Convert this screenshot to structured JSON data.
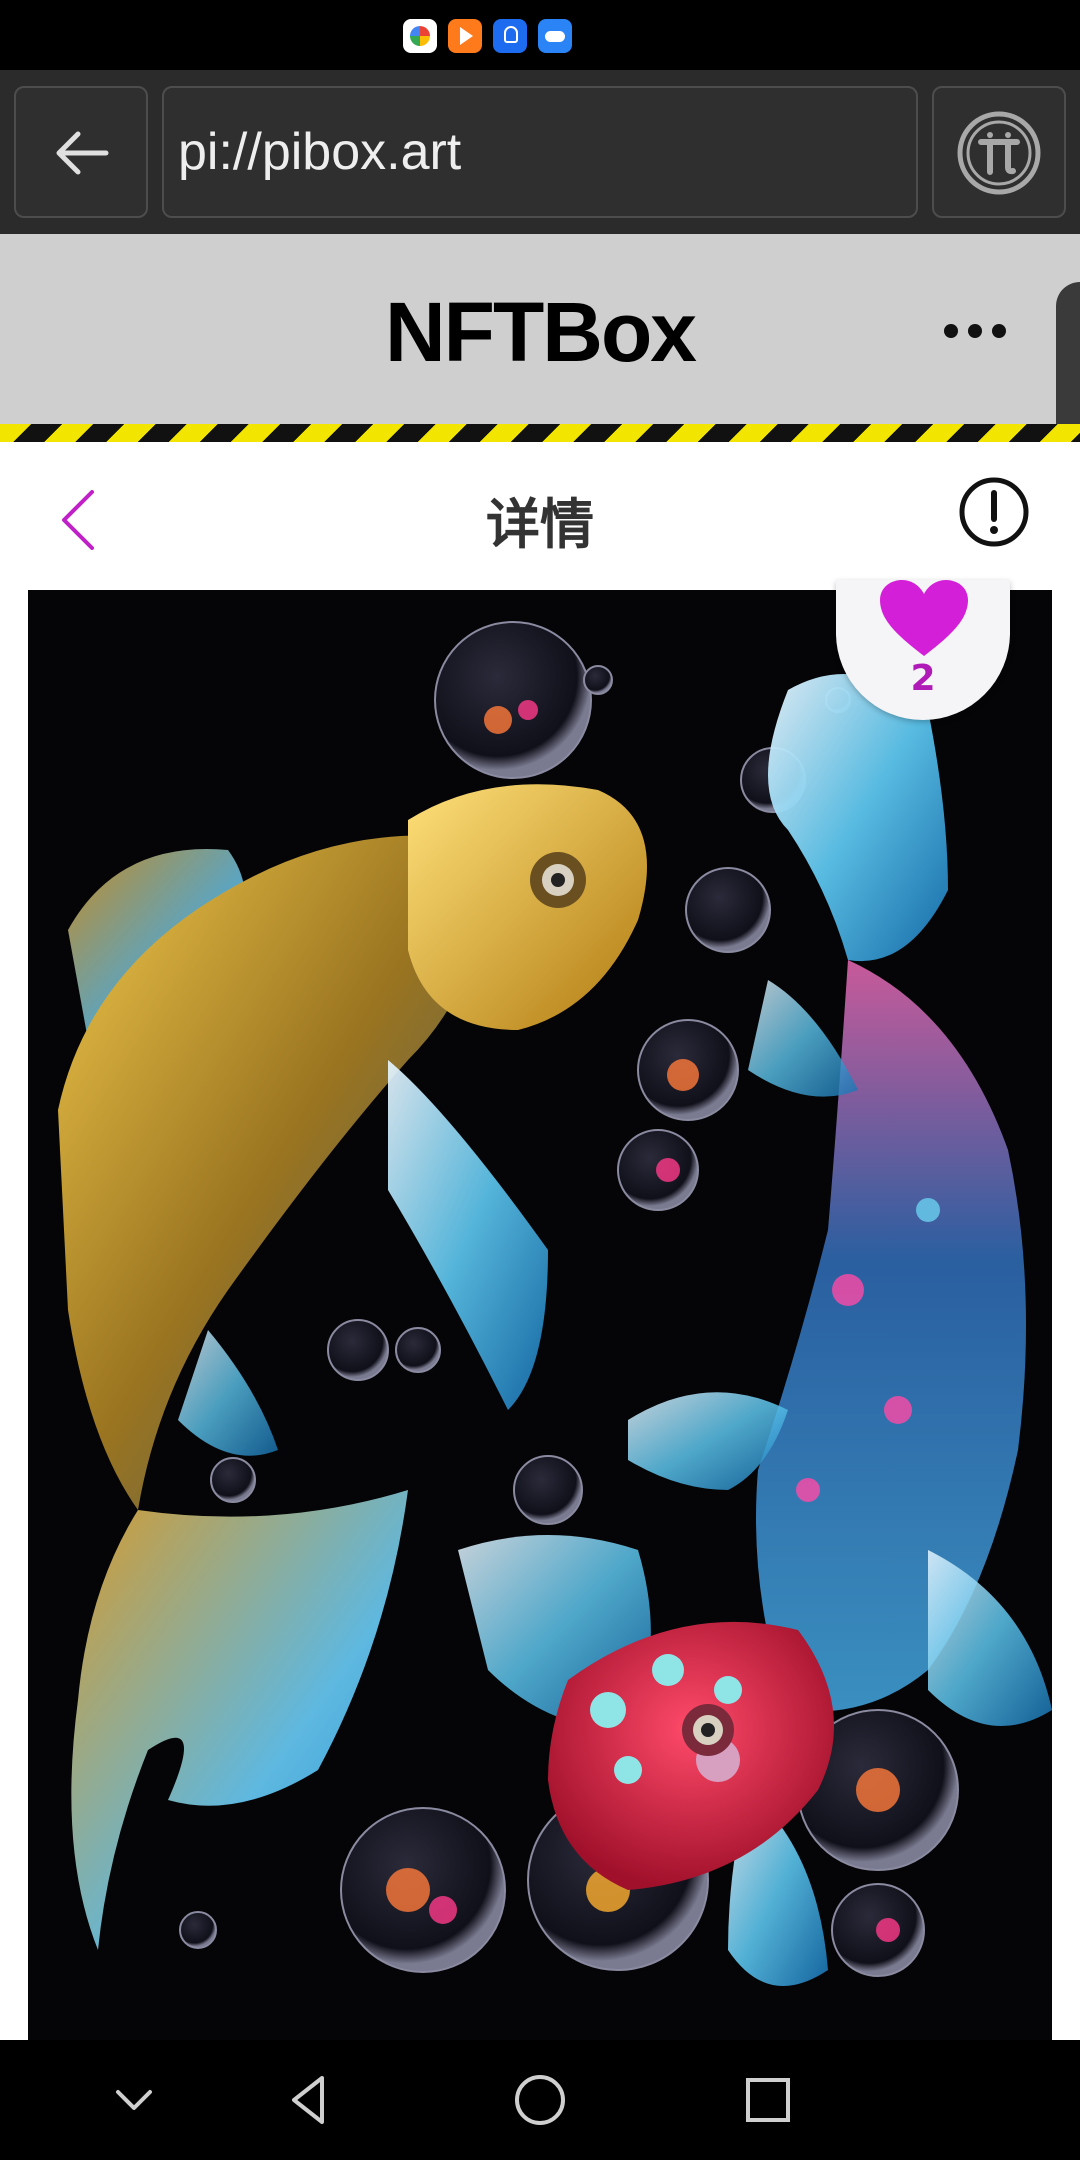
{
  "status_bar": {
    "icons": [
      "chrome-app-icon",
      "video-app-icon",
      "bulb-app-icon",
      "cloud-app-icon"
    ]
  },
  "browser": {
    "url": "pi://pibox.art",
    "back_icon": "back-arrow-icon",
    "pi_icon": "pi-logo-icon"
  },
  "app": {
    "title": "NFTBox",
    "more_icon": "more-dots-icon"
  },
  "detail": {
    "heading": "详情",
    "back_icon": "chevron-left-icon",
    "info_icon": "info-icon",
    "likes": "2",
    "accent_color": "#c020c8"
  },
  "nav_bar": {
    "buttons": [
      "collapse-icon",
      "back-triangle-icon",
      "home-circle-icon",
      "recents-square-icon"
    ]
  }
}
